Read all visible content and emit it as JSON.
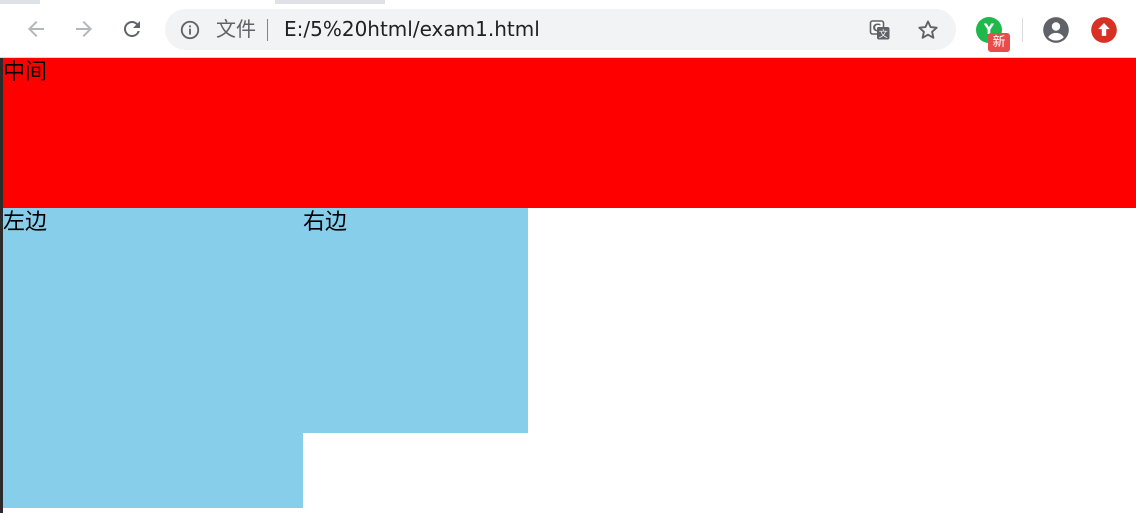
{
  "browser": {
    "address_bar": {
      "scheme_label": "文件",
      "url": "E:/5%20html/exam1.html"
    },
    "extension": {
      "letter": "Y",
      "badge": "新"
    }
  },
  "page": {
    "middle_label": "中间",
    "left_label": "左边",
    "right_label": "右边"
  },
  "colors": {
    "middle_bg": "#ff0000",
    "side_bg": "#87ceeb",
    "extension_green": "#1fb84a",
    "badge_red": "#ea4b4b",
    "update_red": "#d93025"
  },
  "icons": {
    "back": "arrow-left-icon",
    "forward": "arrow-right-icon",
    "reload": "reload-icon",
    "site_info": "info-icon",
    "translate": "translate-icon",
    "bookmark": "star-icon",
    "profile": "account-circle-icon",
    "update": "update-arrow-icon"
  }
}
